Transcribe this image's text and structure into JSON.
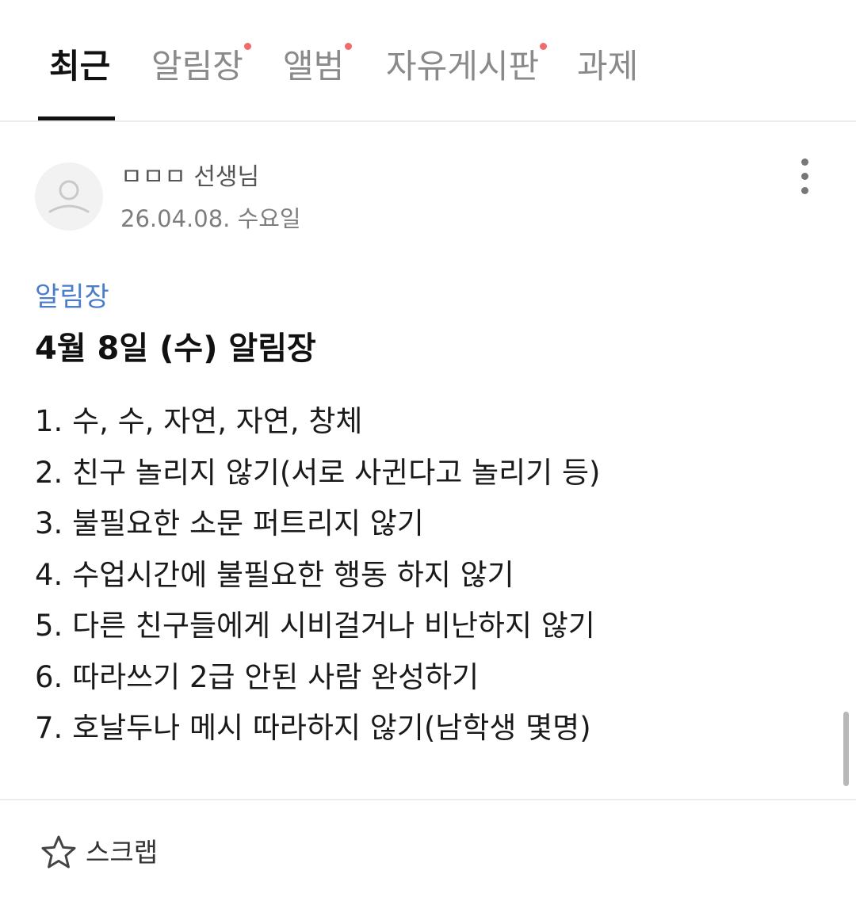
{
  "tabs": [
    {
      "label": "최근",
      "active": true,
      "has_dot": false
    },
    {
      "label": "알림장",
      "active": false,
      "has_dot": true
    },
    {
      "label": "앨범",
      "active": false,
      "has_dot": true
    },
    {
      "label": "자유게시판",
      "active": false,
      "has_dot": true
    },
    {
      "label": "과제",
      "active": false,
      "has_dot": false
    }
  ],
  "colors": {
    "accent_blue": "#4a7ec9",
    "notification_dot": "#f06b6b",
    "tab_inactive": "#8a8a8a",
    "text_primary": "#111111"
  },
  "post": {
    "author": {
      "name": "ㅁㅁㅁ 선생님",
      "date": "26.04.08. 수요일",
      "avatar_icon": "person-icon"
    },
    "more_icon": "more-vertical-icon",
    "category": "알림장",
    "title": "4월 8일 (수) 알림장",
    "lines": [
      "1. 수, 수, 자연, 자연, 창체",
      "2. 친구 놀리지 않기(서로 사귄다고 놀리기 등)",
      "3. 불필요한 소문 퍼트리지 않기",
      "4. 수업시간에 불필요한 행동 하지 않기",
      "5. 다른 친구들에게 시비걸거나 비난하지 않기",
      "6. 따라쓰기 2급 안된 사람 완성하기",
      "7. 호날두나 메시 따라하지 않기(남학생 몇명)"
    ]
  },
  "footer": {
    "scrap_label": "스크랩",
    "scrap_icon": "star-outline-icon"
  }
}
